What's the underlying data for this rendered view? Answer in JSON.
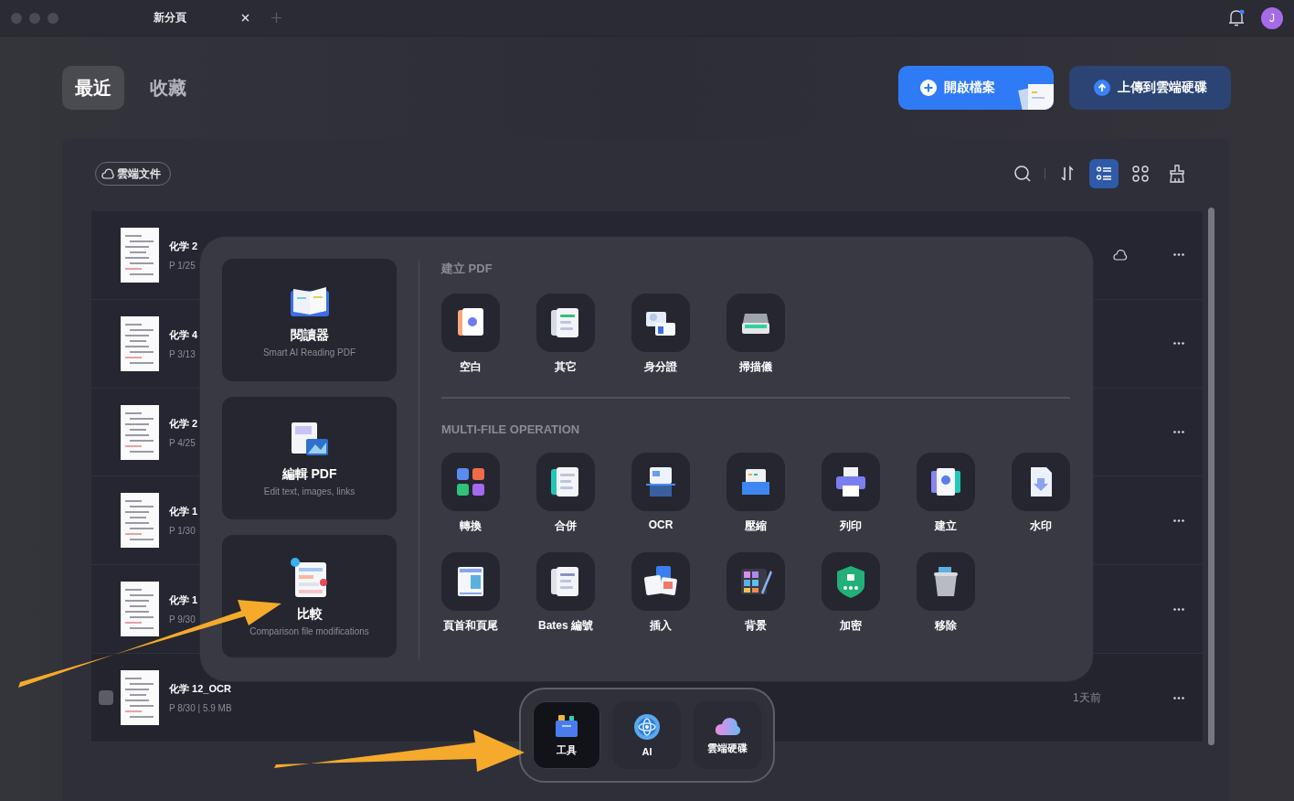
{
  "window": {
    "tab_title": "新分頁",
    "notification": true,
    "avatar_initial": "J"
  },
  "tabs": [
    {
      "label": "最近",
      "selected": true
    },
    {
      "label": "收藏",
      "selected": false
    }
  ],
  "actions": [
    {
      "label": "開啟檔案",
      "kind": "primary"
    },
    {
      "label": "上傳到雲端硬碟",
      "kind": "secondary"
    }
  ],
  "toolbar": {
    "cloud_filter": "雲端文件",
    "view_modes": [
      {
        "kind": "list",
        "selected": true
      },
      {
        "kind": "grid",
        "selected": false
      }
    ]
  },
  "files": [
    {
      "name": "化学 2",
      "meta": "P 1/25",
      "synced": true,
      "hovered": false,
      "checked": false
    },
    {
      "name": "化学 4",
      "meta": "P 3/13",
      "synced": false,
      "hovered": false,
      "checked": false
    },
    {
      "name": "化学 2",
      "meta": "P 4/25",
      "synced": false,
      "hovered": false,
      "checked": false
    },
    {
      "name": "化学 1",
      "meta": "P 1/30",
      "synced": false,
      "hovered": false,
      "checked": false
    },
    {
      "name": "化学 1",
      "meta": "P 9/30",
      "synced": false,
      "hovered": false,
      "checked": false
    },
    {
      "name": "化学 12_OCR",
      "meta": "P 8/30 | 5.9 MB",
      "time": "1天前",
      "synced": false,
      "hovered": true,
      "checked": false
    }
  ],
  "tools_popup": {
    "featured": [
      {
        "title": "閱讀器",
        "subtitle": "Smart AI Reading PDF"
      },
      {
        "title": "編輯 PDF",
        "subtitle": "Edit text, images, links"
      },
      {
        "title": "比較",
        "subtitle": "Comparison file modifications"
      }
    ],
    "sections": [
      {
        "title": "建立 PDF",
        "items": [
          "空白",
          "其它",
          "身分證",
          "掃描儀"
        ]
      },
      {
        "title": "MULTI-FILE OPERATION",
        "items": [
          "轉換",
          "合併",
          "OCR",
          "壓縮",
          "列印",
          "建立",
          "水印",
          "頁首和頁尾",
          "Bates 編號",
          "插入",
          "背景",
          "加密",
          "移除"
        ]
      }
    ]
  },
  "dock": [
    {
      "label": "工具",
      "selected": true
    },
    {
      "label": "AI",
      "selected": false
    },
    {
      "label": "雲端硬碟",
      "selected": false
    }
  ],
  "annotations": [
    {
      "kind": "arrow"
    },
    {
      "kind": "arrow"
    }
  ]
}
